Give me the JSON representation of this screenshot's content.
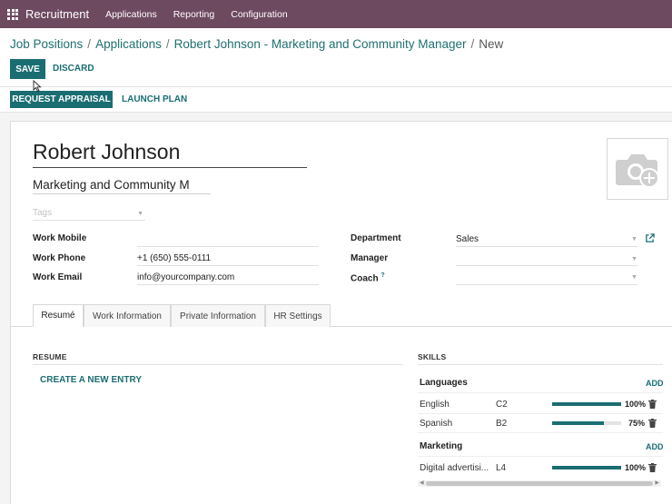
{
  "app": {
    "title": "Recruitment",
    "menu": [
      "Applications",
      "Reporting",
      "Configuration"
    ]
  },
  "breadcrumb": {
    "items": [
      "Job Positions",
      "Applications",
      "Robert Johnson - Marketing and Community Manager"
    ],
    "current": "New"
  },
  "actions": {
    "save": "SAVE",
    "discard": "DISCARD",
    "request_appraisal": "REQUEST APPRAISAL",
    "launch_plan": "LAUNCH PLAN"
  },
  "employee": {
    "name": "Robert Johnson",
    "job_title": "Marketing and Community M",
    "tags_placeholder": "Tags"
  },
  "fields": {
    "work_mobile": {
      "label": "Work Mobile",
      "value": ""
    },
    "work_phone": {
      "label": "Work Phone",
      "value": "+1 (650) 555-0111"
    },
    "work_email": {
      "label": "Work Email",
      "value": "info@yourcompany.com"
    },
    "department": {
      "label": "Department",
      "value": "Sales"
    },
    "manager": {
      "label": "Manager",
      "value": ""
    },
    "coach": {
      "label": "Coach",
      "help": "?",
      "value": ""
    }
  },
  "tabs": [
    "Resumé",
    "Work Information",
    "Private Information",
    "HR Settings"
  ],
  "resume": {
    "title": "RESUME",
    "create_entry": "CREATE A NEW ENTRY"
  },
  "skills": {
    "title": "SKILLS",
    "add_label": "ADD",
    "groups": [
      {
        "name": "Languages",
        "items": [
          {
            "name": "English",
            "level": "C2",
            "progress": 100,
            "percent": "100%"
          },
          {
            "name": "Spanish",
            "level": "B2",
            "progress": 75,
            "percent": "75%"
          }
        ]
      },
      {
        "name": "Marketing",
        "items": [
          {
            "name": "Digital advertisi...",
            "level": "L4",
            "progress": 100,
            "percent": "100%"
          }
        ]
      }
    ]
  },
  "colors": {
    "topbar": "#6e4a61",
    "primary": "#1a6e72"
  }
}
